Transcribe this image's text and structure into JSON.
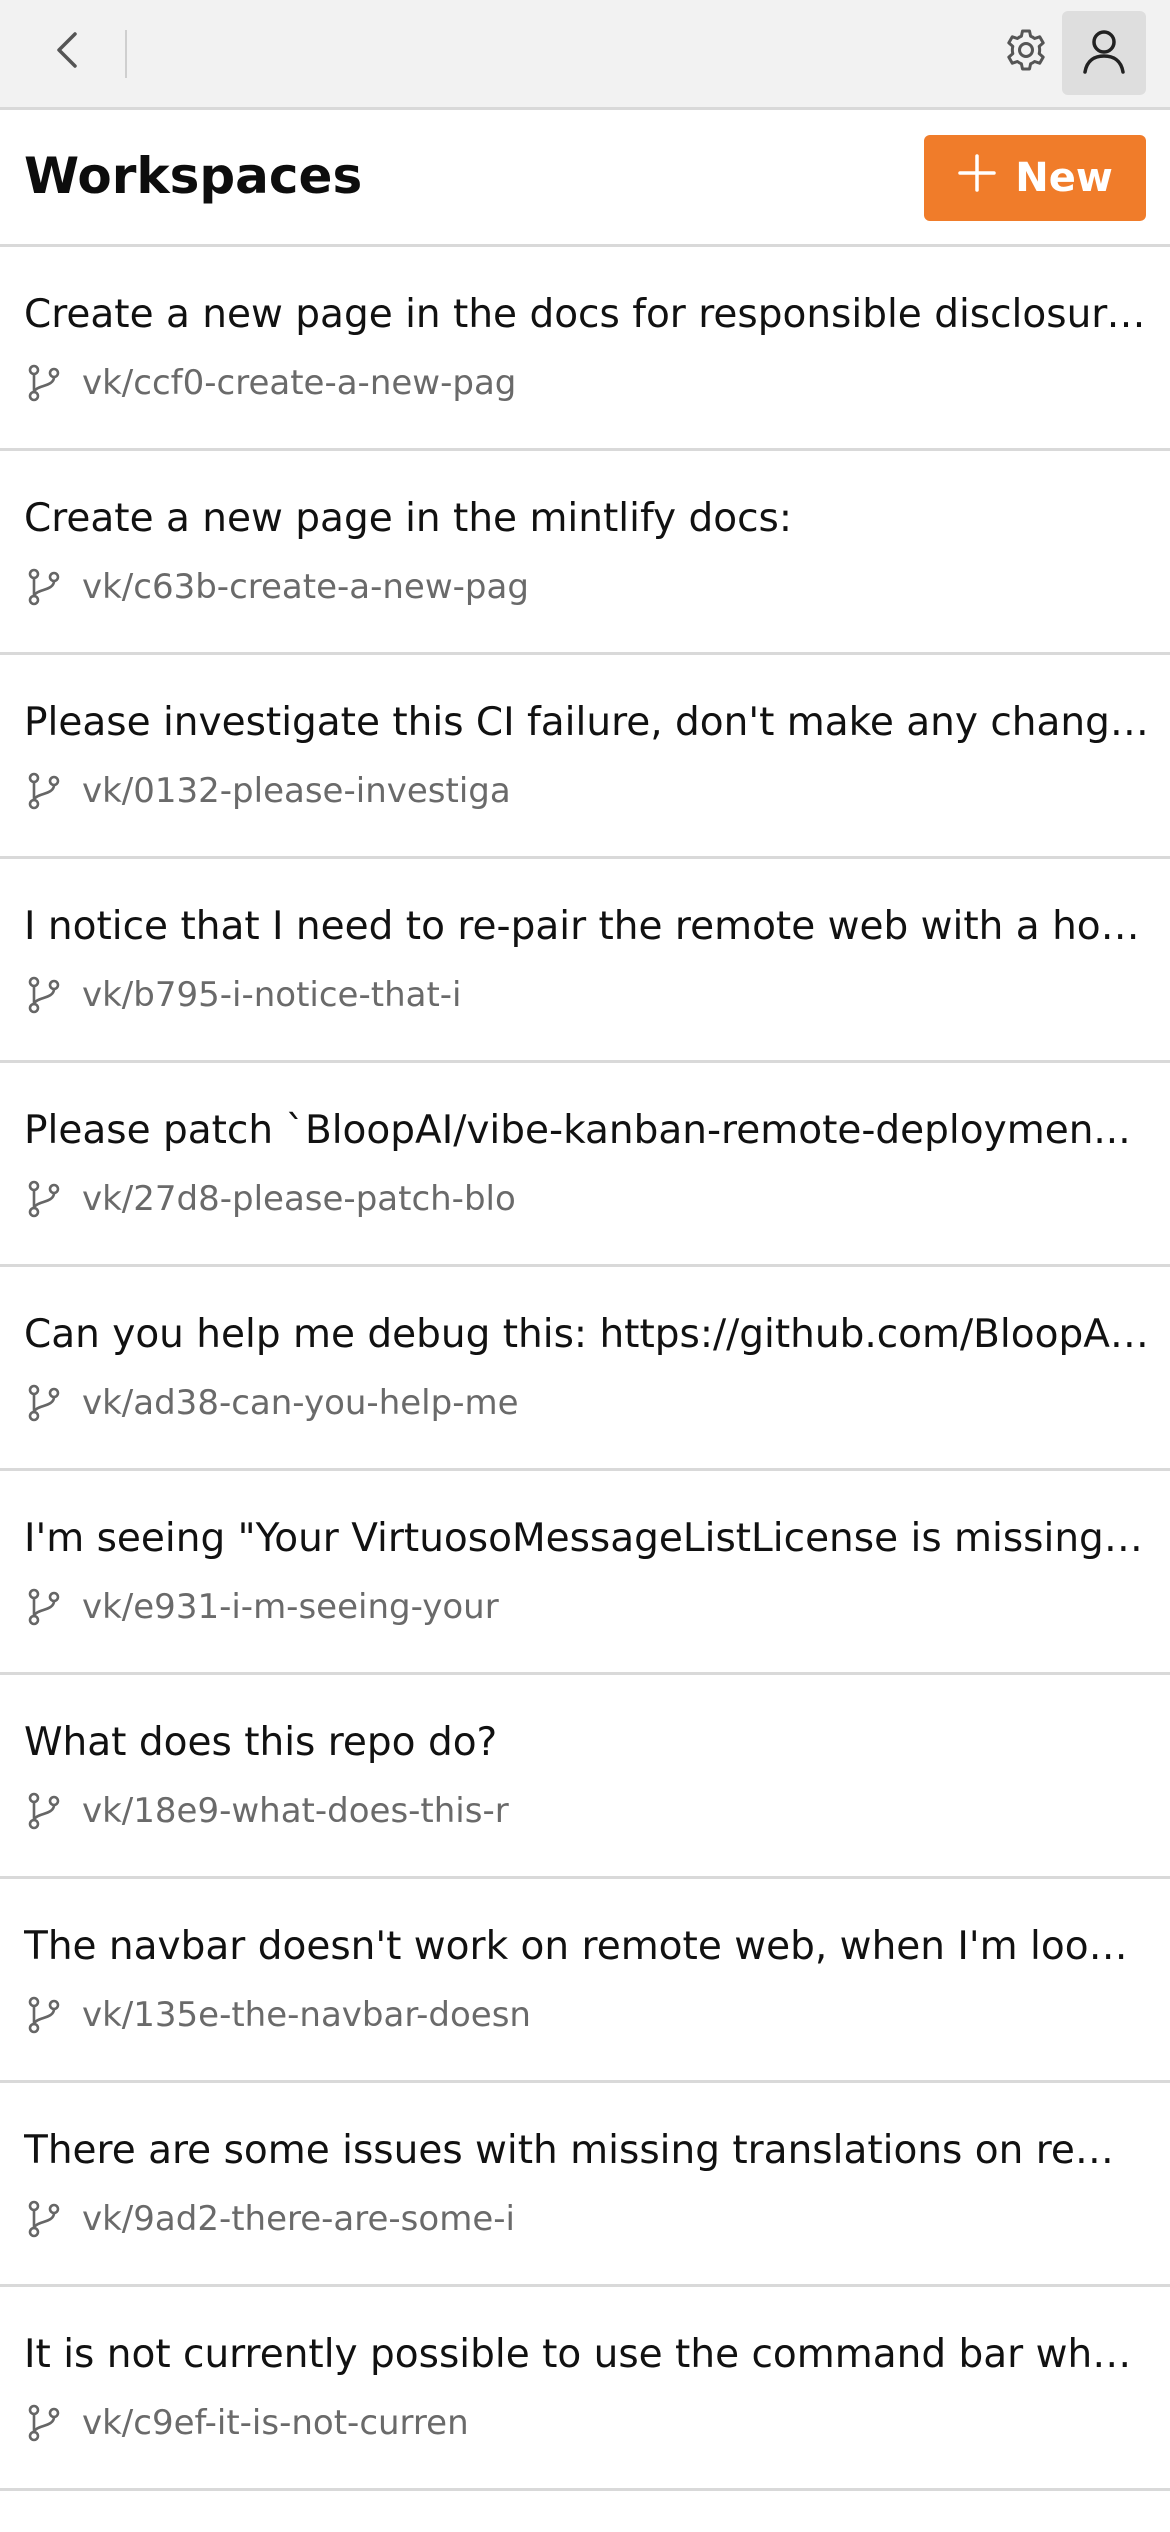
{
  "header": {
    "title": "Workspaces",
    "new_button_label": "New"
  },
  "icons": {
    "back": "chevron-left-icon",
    "settings": "gear-icon",
    "profile": "user-icon",
    "add": "plus-icon",
    "branch": "git-branch-icon"
  },
  "colors": {
    "accent": "#f07c2a",
    "topbar_bg": "#f2f2f2",
    "profile_bg": "#dedede",
    "divider": "#d9d9d9",
    "branch_text": "#6a6a6a"
  },
  "workspaces": [
    {
      "title": "Create a new page in the docs for responsible disclosure...",
      "branch": "vk/ccf0-create-a-new-pag"
    },
    {
      "title": "Create a new page in the mintlify docs:",
      "branch": "vk/c63b-create-a-new-pag"
    },
    {
      "title": "Please investigate this CI failure, don't make any change...",
      "branch": "vk/0132-please-investiga"
    },
    {
      "title": "I notice that I need to re-pair the remote web with a hos...",
      "branch": "vk/b795-i-notice-that-i"
    },
    {
      "title": "Please patch `BloopAI/vibe-kanban-remote-deploymen...",
      "branch": "vk/27d8-please-patch-blo"
    },
    {
      "title": "Can you help me debug this: https://github.com/BloopAI...",
      "branch": "vk/ad38-can-you-help-me"
    },
    {
      "title": "I'm seeing \"Your VirtuosoMessageListLicense is missing ...",
      "branch": "vk/e931-i-m-seeing-your"
    },
    {
      "title": "What does this repo do?",
      "branch": "vk/18e9-what-does-this-r"
    },
    {
      "title": "The navbar doesn't work on remote web, when I'm looki...",
      "branch": "vk/135e-the-navbar-doesn"
    },
    {
      "title": "There are some issues with missing translations on rem...",
      "branch": "vk/9ad2-there-are-some-i"
    },
    {
      "title": "It is not currently possible to use the command bar whe...",
      "branch": "vk/c9ef-it-is-not-curren"
    }
  ]
}
